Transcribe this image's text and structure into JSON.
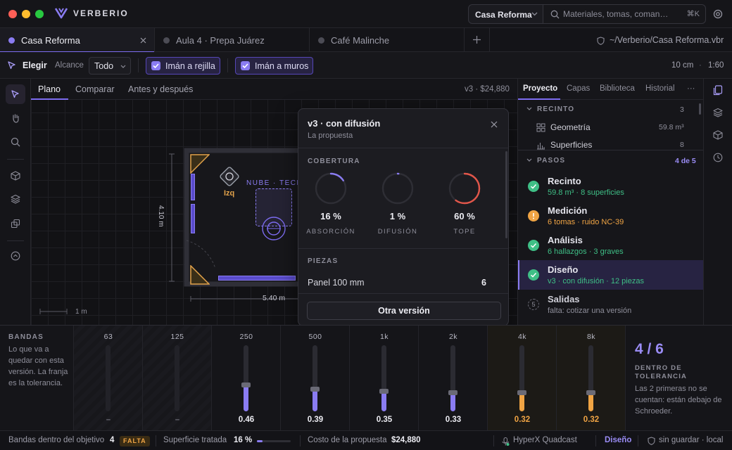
{
  "app": {
    "name": "VERBERIO"
  },
  "header": {
    "project_select": "Casa Reforma",
    "search_placeholder": "Materiales, tomas, coman…",
    "search_shortcut": "⌘K"
  },
  "tabs": [
    {
      "label": "Casa Reforma",
      "active": true
    },
    {
      "label": "Aula 4 · Prepa Juárez",
      "active": false
    },
    {
      "label": "Café Malinche",
      "active": false
    }
  ],
  "file_path": "~/Verberio/Casa Reforma.vbr",
  "toolbar": {
    "tool": "Elegir",
    "scope_label": "Alcance",
    "scope_value": "Todo",
    "snap_grid": "Imán a rejilla",
    "snap_walls": "Imán a muros",
    "scale_unit": "10 cm",
    "scale_sep": "·",
    "scale_ratio": "1:60"
  },
  "canvas": {
    "tabs": [
      "Plano",
      "Comparar",
      "Antes y después"
    ],
    "active_tab": "Plano",
    "version_info": "v3 · $24,880",
    "dim_height": "4.10 m",
    "dim_width": "5.40 m",
    "scale_bar": "1 m",
    "source_label": "Izq",
    "zone_label": "NUBE · TECHO"
  },
  "popover": {
    "title": "v3 · con difusión",
    "subtitle": "La propuesta",
    "coverage_title": "COBERTURA",
    "gauges": [
      {
        "value": "16 %",
        "label": "ABSORCIÓN",
        "fraction": 0.16,
        "color": "#8a7cf2"
      },
      {
        "value": "1 %",
        "label": "DIFUSIÓN",
        "fraction": 0.01,
        "color": "#8a7cf2"
      },
      {
        "value": "60 %",
        "label": "TOPE",
        "fraction": 0.6,
        "color": "#e2564a"
      }
    ],
    "pieces_title": "PIEZAS",
    "pieces": [
      {
        "name": "Panel 100 mm",
        "count": "6"
      }
    ],
    "button": "Otra versión"
  },
  "right_panel": {
    "tabs": [
      "Proyecto",
      "Capas",
      "Biblioteca",
      "Historial"
    ],
    "active_tab": "Proyecto",
    "more": "···",
    "recinto": {
      "title": "RECINTO",
      "count": "3",
      "items": [
        {
          "label": "Geometría",
          "value": "59.8 m³"
        },
        {
          "label": "Superficies",
          "value": "8"
        }
      ]
    },
    "pasos": {
      "title": "PASOS",
      "progress": "4 de 5",
      "steps": [
        {
          "name": "Recinto",
          "detail": "59.8 m³ · 8 superficies",
          "status": "done"
        },
        {
          "name": "Medición",
          "detail": "6 tomas · ruido NC-39",
          "status": "warn"
        },
        {
          "name": "Análisis",
          "detail": "6 hallazgos · 3 graves",
          "status": "done"
        },
        {
          "name": "Diseño",
          "detail": "v3 · con difusión · 12 piezas",
          "status": "done",
          "selected": true
        },
        {
          "name": "Salidas",
          "detail": "falta: cotizar una versión",
          "status": "pending",
          "number": "5"
        }
      ]
    }
  },
  "bands": {
    "title": "BANDAS",
    "description": "Lo que va a quedar con esta versión. La franja es la tolerancia.",
    "items": [
      {
        "freq": "63",
        "value": "–",
        "level": 0,
        "state": "inactive"
      },
      {
        "freq": "125",
        "value": "–",
        "level": 0,
        "state": "inactive"
      },
      {
        "freq": "250",
        "value": "0.46",
        "level": 0.46,
        "state": "ok"
      },
      {
        "freq": "500",
        "value": "0.39",
        "level": 0.39,
        "state": "ok"
      },
      {
        "freq": "1k",
        "value": "0.35",
        "level": 0.35,
        "state": "ok"
      },
      {
        "freq": "2k",
        "value": "0.33",
        "level": 0.33,
        "state": "ok"
      },
      {
        "freq": "4k",
        "value": "0.32",
        "level": 0.32,
        "state": "warn"
      },
      {
        "freq": "8k",
        "value": "0.32",
        "level": 0.32,
        "state": "warn"
      }
    ],
    "summary": {
      "value": "4 / 6",
      "label": "DENTRO DE TOLERANCIA",
      "note": "Las 2 primeras no se cuentan: están debajo de Schroeder."
    }
  },
  "status": {
    "bands_label": "Bandas dentro del objetivo",
    "bands_value": "4",
    "bands_badge": "FALTA",
    "surface_label": "Superficie tratada",
    "surface_value": "16 %",
    "surface_fraction": 0.16,
    "cost_label": "Costo de la propuesta",
    "cost_value": "$24,880",
    "device": "HyperX Quadcast",
    "mode": "Diseño",
    "save_state": "sin guardar · local"
  },
  "colors": {
    "accent": "#8a7cf2",
    "ok": "#3fbf86",
    "warn": "#f0a444",
    "danger": "#e2564a"
  }
}
